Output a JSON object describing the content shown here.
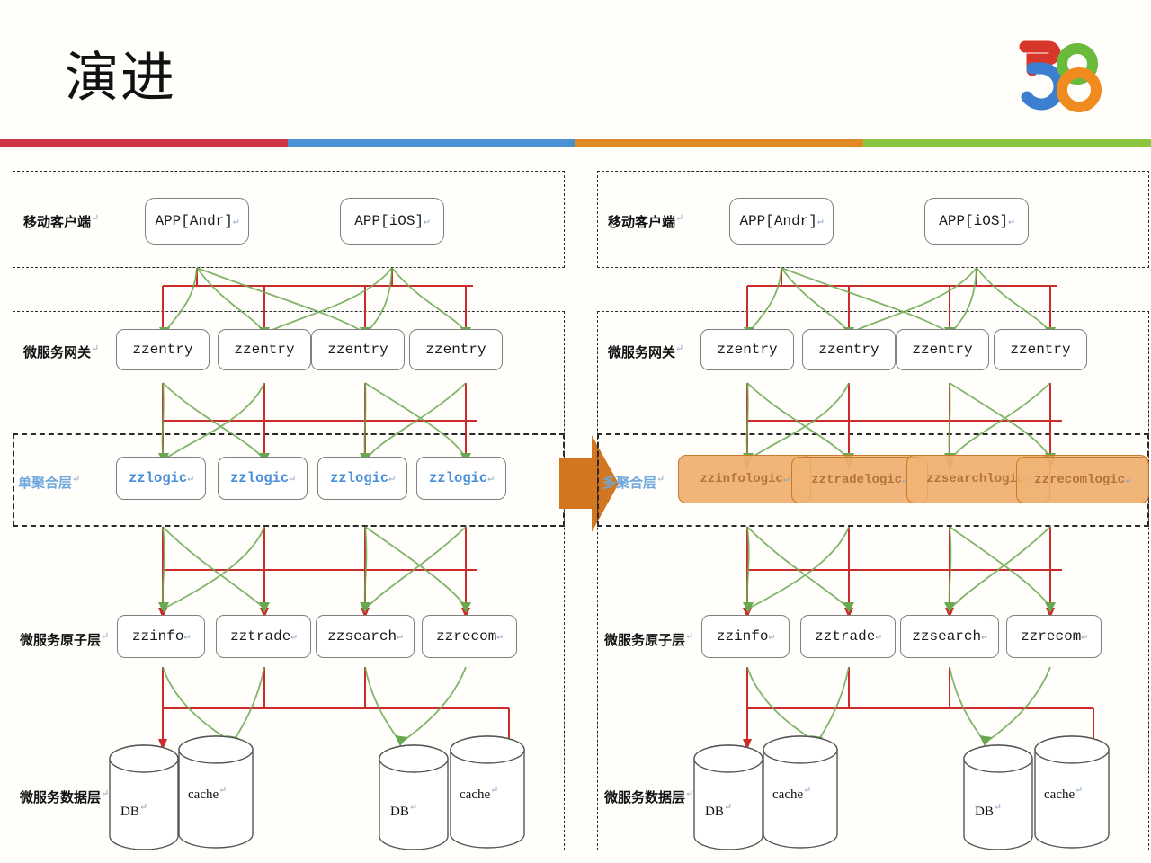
{
  "slide": {
    "title": "演进",
    "logo_name": "58-logo",
    "divider_colors": [
      "#cc3344",
      "#4a90d2",
      "#e08a26",
      "#8cc63e"
    ]
  },
  "logo": {
    "five_top_color": "#d8362a",
    "five_bottom_color": "#3c7fd0",
    "eight_top_color": "#6aba3c",
    "eight_bottom_color": "#ef8b1f"
  },
  "return_mark": "↵",
  "colors": {
    "red_line": "#cc2b2b",
    "green_line": "#6aa84f",
    "orange_fill": "#eda961",
    "orange_stroke": "#c8792b",
    "logic_blue": "#4a90d9",
    "label_blue": "#6fa8dc",
    "box_stroke": "#7f7f7f",
    "dash_stroke": "#2a2a2a"
  },
  "left_panel": {
    "name": "single-aggregation-architecture",
    "rows": [
      {
        "id": "mobile-client",
        "label": "移动客户端",
        "label_color": "#111111",
        "nodes": [
          "APP[Andr]",
          "APP[iOS]"
        ]
      },
      {
        "id": "microservice-gateway",
        "label": "微服务网关",
        "label_color": "#111111",
        "nodes": [
          "zzentry",
          "zzentry",
          "zzentry",
          "zzentry"
        ]
      },
      {
        "id": "aggregation-layer",
        "label": "单聚合层",
        "label_color": "#6fa8dc",
        "nodes": [
          "zzlogic",
          "zzlogic",
          "zzlogic",
          "zzlogic"
        ]
      },
      {
        "id": "microservice-atomic",
        "label": "微服务原子层",
        "label_color": "#111111",
        "nodes": [
          "zzinfo",
          "zztrade",
          "zzsearch",
          "zzrecom"
        ]
      },
      {
        "id": "microservice-data",
        "label": "微服务数据层",
        "label_color": "#111111",
        "nodes": [
          "DB",
          "cache",
          "DB",
          "cache"
        ]
      }
    ]
  },
  "right_panel": {
    "name": "multi-aggregation-architecture",
    "rows": [
      {
        "id": "mobile-client",
        "label": "移动客户端",
        "label_color": "#111111",
        "nodes": [
          "APP[Andr]",
          "APP[iOS]"
        ]
      },
      {
        "id": "microservice-gateway",
        "label": "微服务网关",
        "label_color": "#111111",
        "nodes": [
          "zzentry",
          "zzentry",
          "zzentry",
          "zzentry"
        ]
      },
      {
        "id": "aggregation-layer",
        "label": "多聚合层",
        "label_color": "#6fa8dc",
        "nodes": [
          "zzinfologic",
          "zztradelogic",
          "zzsearchlogic",
          "zzrecomlogic"
        ]
      },
      {
        "id": "microservice-atomic",
        "label": "微服务原子层",
        "label_color": "#111111",
        "nodes": [
          "zzinfo",
          "zztrade",
          "zzsearch",
          "zzrecom"
        ]
      },
      {
        "id": "microservice-data",
        "label": "微服务数据层",
        "label_color": "#111111",
        "nodes": [
          "DB",
          "cache",
          "DB",
          "cache"
        ]
      }
    ]
  },
  "transition": {
    "icon": "right-block-arrow-icon",
    "color": "#d2761f"
  }
}
